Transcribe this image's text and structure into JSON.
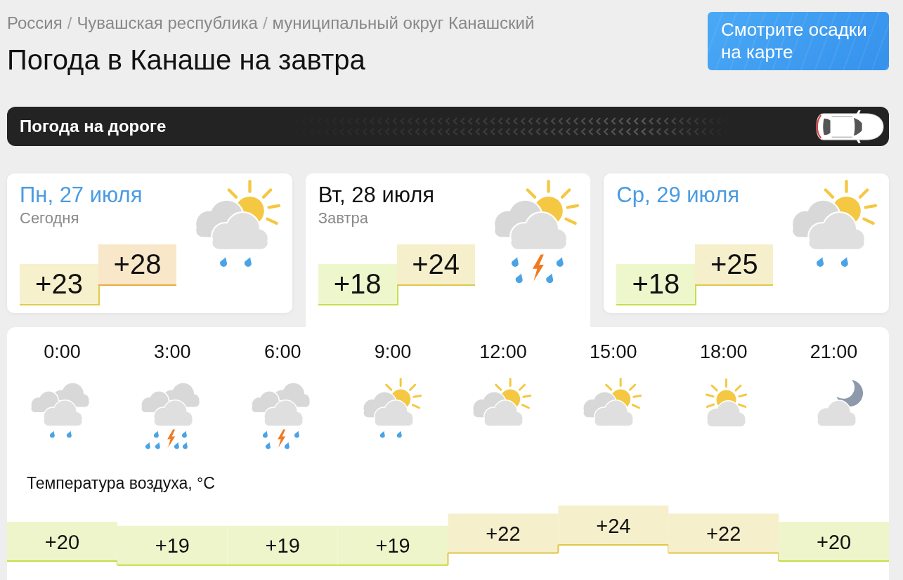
{
  "breadcrumb": [
    {
      "kind": "link",
      "text": "Россия"
    },
    {
      "kind": "separator",
      "text": "/"
    },
    {
      "kind": "link",
      "text": "Чувашская республика"
    },
    {
      "kind": "separator",
      "text": "/"
    },
    {
      "kind": "link",
      "text": "муниципальный округ Канашский"
    }
  ],
  "title": "Погода в Канаше на завтра",
  "map_button": "Смотрите осадки на карте",
  "road_banner": {
    "label": "Погода на дороге"
  },
  "days": [
    {
      "date": "Пн, 27 июля",
      "note": "Сегодня",
      "selected": false,
      "kind": "partly-cloudy-rain",
      "low": {
        "value": "+23",
        "color": "#f6f0cc"
      },
      "high": {
        "value": "+28",
        "color": "#f9e7c9"
      }
    },
    {
      "date": "Вт, 28 июля",
      "note": "Завтра",
      "selected": true,
      "kind": "partly-cloudy-thunderstorm",
      "low": {
        "value": "+18",
        "color": "#eef6cc"
      },
      "high": {
        "value": "+24",
        "color": "#f6efcc"
      }
    },
    {
      "date": "Ср, 29 июля",
      "selected": false,
      "kind": "partly-cloudy-rain",
      "low": {
        "value": "+18",
        "color": "#eef6cc"
      },
      "high": {
        "value": "+25",
        "color": "#f6efcc"
      }
    }
  ],
  "hourly": {
    "hours": [
      {
        "time": "0:00",
        "kind": "cloudy-rain"
      },
      {
        "time": "3:00",
        "kind": "cloudy-heavy-thunderstorm"
      },
      {
        "time": "6:00",
        "kind": "cloudy-thunderstorm"
      },
      {
        "time": "9:00",
        "kind": "partly-cloudy-rain"
      },
      {
        "time": "12:00",
        "kind": "partly-cloudy"
      },
      {
        "time": "15:00",
        "kind": "partly-cloudy"
      },
      {
        "time": "18:00",
        "kind": "sun-cloud"
      },
      {
        "time": "21:00",
        "kind": "night-cloud"
      }
    ],
    "temperature": {
      "title": "Температура воздуха, °C",
      "readings": [
        {
          "value": "+20",
          "color": "#eff5cb"
        },
        {
          "value": "+19",
          "color": "#eff5cb"
        },
        {
          "value": "+19",
          "color": "#eff5cb"
        },
        {
          "value": "+19",
          "color": "#eff5cb"
        },
        {
          "value": "+22",
          "color": "#f6efcb"
        },
        {
          "value": "+24",
          "color": "#f6efcb"
        },
        {
          "value": "+22",
          "color": "#f6efcb"
        },
        {
          "value": "+20",
          "color": "#eff5cb"
        }
      ]
    }
  }
}
